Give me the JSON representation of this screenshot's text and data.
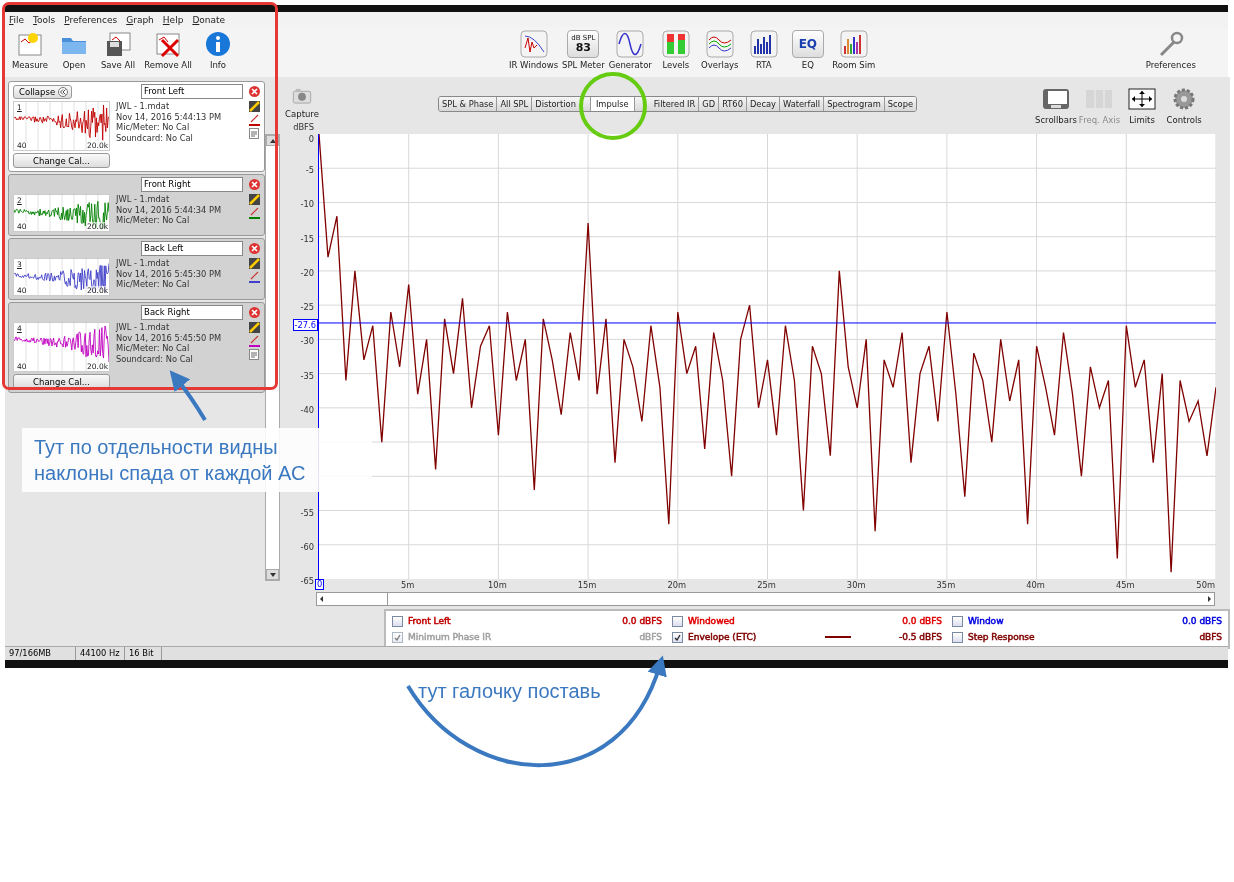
{
  "menu": [
    "File",
    "Tools",
    "Preferences",
    "Graph",
    "Help",
    "Donate"
  ],
  "toolbar_left": [
    {
      "label": "Measure"
    },
    {
      "label": "Open"
    },
    {
      "label": "Save All"
    },
    {
      "label": "Remove All"
    },
    {
      "label": "Info"
    }
  ],
  "toolbar_center": [
    {
      "label": "IR Windows"
    },
    {
      "label": "SPL Meter",
      "badge_top": "dB SPL",
      "badge_value": "83"
    },
    {
      "label": "Generator"
    },
    {
      "label": "Levels"
    },
    {
      "label": "Overlays"
    },
    {
      "label": "RTA"
    },
    {
      "label": "EQ",
      "badge_value": "EQ"
    },
    {
      "label": "Room Sim"
    }
  ],
  "preferences": "Preferences",
  "collapse": "Collapse",
  "measurements": [
    {
      "number": "1",
      "name": "Front Left",
      "file": "JWL - 1.mdat",
      "date": "Nov 14, 2016 5:44:13 PM",
      "mic": "Mic/Meter: No Cal",
      "soundcard": "Soundcard: No Cal",
      "x_min": "40",
      "x_max": "20.0k",
      "color": "#c00000",
      "selected": true,
      "expanded": true,
      "button": "Change Cal..."
    },
    {
      "number": "2",
      "name": "Front Right",
      "file": "JWL - 1.mdat",
      "date": "Nov 14, 2016 5:44:34 PM",
      "mic": "Mic/Meter: No Cal",
      "x_min": "40",
      "x_max": "20.0k",
      "color": "#008000",
      "selected": false,
      "expanded": false
    },
    {
      "number": "3",
      "name": "Back Left",
      "file": "JWL - 1.mdat",
      "date": "Nov 14, 2016 5:45:30 PM",
      "mic": "Mic/Meter: No Cal",
      "x_min": "40",
      "x_max": "20.0k",
      "color": "#4040c8",
      "selected": false,
      "expanded": false
    },
    {
      "number": "4",
      "name": "Back Right",
      "file": "JWL - 1.mdat",
      "date": "Nov 14, 2016 5:45:50 PM",
      "mic": "Mic/Meter: No Cal",
      "soundcard": "Soundcard: No Cal",
      "x_min": "40",
      "x_max": "20.0k",
      "color": "#c000c0",
      "selected": false,
      "expanded": true,
      "button": "Change Cal..."
    }
  ],
  "capture": "Capture",
  "tabs": [
    {
      "label": "SPL & Phase",
      "selected": false
    },
    {
      "label": "All SPL",
      "selected": false
    },
    {
      "label": "Distortion",
      "selected": false
    },
    {
      "label": "Impulse",
      "selected": true
    },
    {
      "label": "Filtered IR",
      "selected": false
    },
    {
      "label": "GD",
      "selected": false
    },
    {
      "label": "RT60",
      "selected": false
    },
    {
      "label": "Decay",
      "selected": false
    },
    {
      "label": "Waterfall",
      "selected": false
    },
    {
      "label": "Spectrogram",
      "selected": false
    },
    {
      "label": "Scope",
      "selected": false
    }
  ],
  "graph_tools": [
    {
      "label": "Scrollbars",
      "disabled": false
    },
    {
      "label": "Freq. Axis",
      "disabled": true
    },
    {
      "label": "Limits",
      "disabled": false
    },
    {
      "label": "Controls",
      "disabled": false
    }
  ],
  "graph": {
    "chart_data": {
      "type": "line",
      "ylabel": "dBFS",
      "xlim": [
        0,
        50
      ],
      "ylim": [
        -65,
        0
      ],
      "xticks": [
        {
          "value": 0,
          "label": "0"
        },
        {
          "value": 5,
          "label": "5m"
        },
        {
          "value": 10,
          "label": "10m"
        },
        {
          "value": 15,
          "label": "15m"
        },
        {
          "value": 20,
          "label": "20m"
        },
        {
          "value": 25,
          "label": "25m"
        },
        {
          "value": 30,
          "label": "30m"
        },
        {
          "value": 35,
          "label": "35m"
        },
        {
          "value": 40,
          "label": "40m"
        },
        {
          "value": 45,
          "label": "45m"
        },
        {
          "value": 50,
          "label": "50m"
        }
      ],
      "yticks": [
        0,
        -5,
        -10,
        -15,
        -20,
        -25,
        -30,
        -35,
        -40,
        -55,
        -60,
        -65
      ],
      "x": [
        0,
        0.5,
        1,
        1.5,
        2,
        2.5,
        3,
        3.5,
        4,
        4.5,
        5,
        5.5,
        6,
        6.5,
        7,
        7.5,
        8,
        8.5,
        9,
        9.5,
        10,
        10.5,
        11,
        11.5,
        12,
        12.5,
        13,
        13.5,
        14,
        14.5,
        15,
        15.5,
        16,
        16.5,
        17,
        17.5,
        18,
        18.5,
        19,
        19.5,
        20,
        20.5,
        21,
        21.5,
        22,
        22.5,
        23,
        23.5,
        24,
        24.5,
        25,
        25.5,
        26,
        26.5,
        27,
        27.5,
        28,
        28.5,
        29,
        29.5,
        30,
        30.5,
        31,
        31.5,
        32,
        32.5,
        33,
        33.5,
        34,
        34.5,
        35,
        35.5,
        36,
        36.5,
        37,
        37.5,
        38,
        38.5,
        39,
        39.5,
        40,
        40.5,
        41,
        41.5,
        42,
        42.5,
        43,
        43.5,
        44,
        44.5,
        45,
        45.5,
        46,
        46.5,
        47,
        47.5,
        48,
        48.5,
        49,
        49.5,
        50
      ],
      "grid": true,
      "series": [
        {
          "color": "#800000",
          "values": [
            0,
            -18,
            -12,
            -36,
            -20,
            -33,
            -28,
            -45,
            -26,
            -34,
            -22,
            -38,
            -30,
            -49,
            -27,
            -35,
            -24,
            -40,
            -31,
            -28,
            -44,
            -26,
            -36,
            -30,
            -52,
            -27,
            -33,
            -41,
            -29,
            -36,
            -13,
            -38,
            -27,
            -48,
            -30,
            -34,
            -42,
            -28,
            -37,
            -57,
            -26,
            -35,
            -31,
            -46,
            -29,
            -36,
            -50,
            -30,
            -25,
            -40,
            -33,
            -44,
            -28,
            -36,
            -55,
            -31,
            -35,
            -47,
            -20,
            -34,
            -40,
            -30,
            -58,
            -33,
            -37,
            -29,
            -48,
            -35,
            -31,
            -42,
            -26,
            -38,
            -53,
            -32,
            -36,
            -45,
            -30,
            -39,
            -33,
            -57,
            -31,
            -37,
            -44,
            -29,
            -38,
            -50,
            -34,
            -40,
            -36,
            -62,
            -28,
            -37,
            -33,
            -48,
            -35,
            -64,
            -36,
            -42,
            -39,
            -47,
            -37
          ]
        }
      ],
      "ref_lines": [
        {
          "axis": "y",
          "value": -27.6,
          "label": "-27.6"
        }
      ]
    }
  },
  "legend": [
    {
      "label": "Front Left",
      "checked": false,
      "disabled": false,
      "reading": "0.0 dBFS",
      "color": "#c00000"
    },
    {
      "label": "Windowed",
      "checked": false,
      "disabled": false,
      "reading": "0.0 dBFS",
      "color": "#e00000"
    },
    {
      "label": "Window",
      "checked": false,
      "disabled": false,
      "reading": "0.0 dBFS",
      "color": "#0000e0"
    },
    {
      "label": "Minimum Phase IR",
      "checked": true,
      "disabled": true,
      "reading": "dBFS",
      "color": "#a0a0a0"
    },
    {
      "label": "Envelope (ETC)",
      "checked": true,
      "disabled": false,
      "reading": "-0.5 dBFS",
      "color": "#800000"
    },
    {
      "label": "Step Response",
      "checked": false,
      "disabled": false,
      "reading": "dBFS",
      "color": "#800000"
    }
  ],
  "status_bar": [
    "97/166MB",
    "44100 Hz",
    "16 Bit"
  ],
  "annotations": {
    "callout": "Тут по отдельности видны\nнаклоны спада от каждой АС",
    "note": "тут галочку поставь"
  }
}
